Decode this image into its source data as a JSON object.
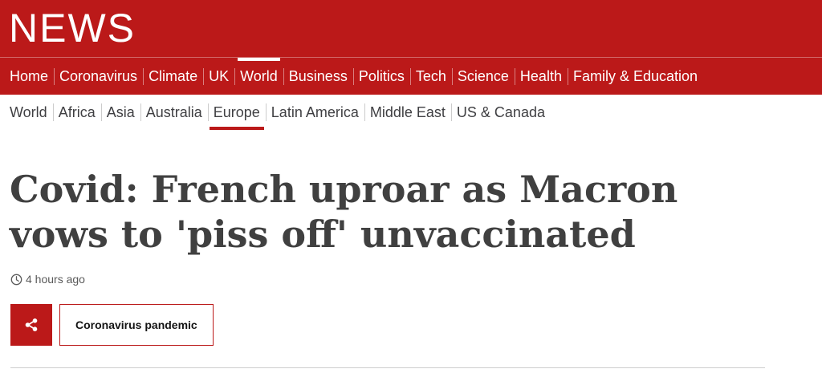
{
  "brand": {
    "logo_text": "NEWS",
    "color_primary": "#bb1919"
  },
  "top_nav": {
    "items": [
      {
        "label": "Home"
      },
      {
        "label": "Coronavirus"
      },
      {
        "label": "Climate"
      },
      {
        "label": "UK"
      },
      {
        "label": "World",
        "active": true
      },
      {
        "label": "Business"
      },
      {
        "label": "Politics"
      },
      {
        "label": "Tech"
      },
      {
        "label": "Science"
      },
      {
        "label": "Health"
      },
      {
        "label": "Family & Education"
      }
    ]
  },
  "sub_nav": {
    "items": [
      {
        "label": "World"
      },
      {
        "label": "Africa"
      },
      {
        "label": "Asia"
      },
      {
        "label": "Australia"
      },
      {
        "label": "Europe",
        "active": true
      },
      {
        "label": "Latin America"
      },
      {
        "label": "Middle East"
      },
      {
        "label": "US & Canada"
      }
    ]
  },
  "article": {
    "headline": "Covid: French uproar as Macron vows to 'piss off' unvaccinated",
    "timestamp": "4 hours ago",
    "share_icon": "share-icon",
    "topic_tag": "Coronavirus pandemic"
  }
}
